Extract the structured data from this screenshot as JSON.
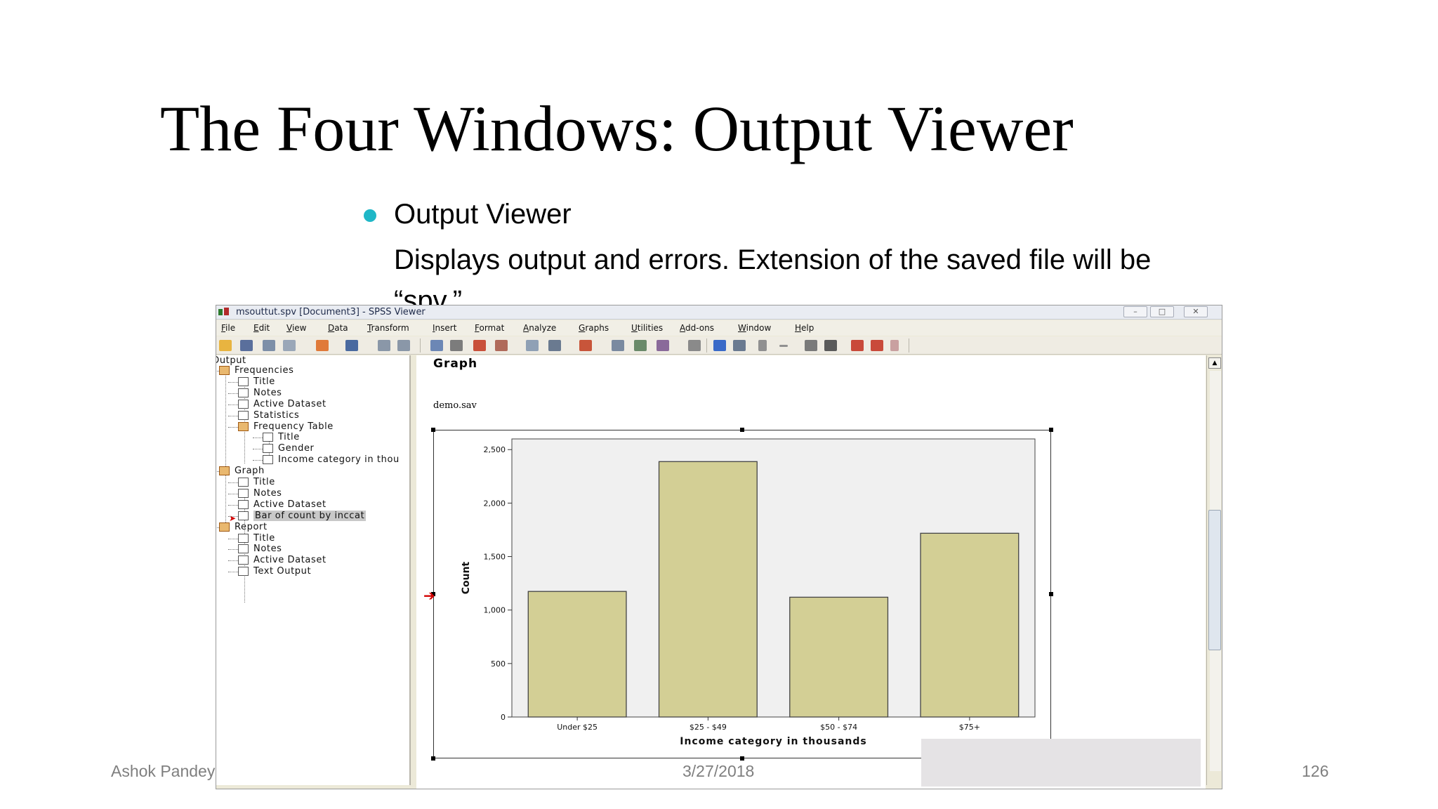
{
  "slide": {
    "title": "The Four Windows: Output Viewer",
    "bullet_heading": "Output Viewer",
    "bullet_text": "Displays output and errors. Extension of the saved file will be “spv.”",
    "bullet_color": "#1fb7c7"
  },
  "footer": {
    "author": "Ashok Pandey",
    "date": "3/27/2018",
    "page_number": "126"
  },
  "window": {
    "title": "msouttut.spv [Document3] - SPSS Viewer",
    "controls": [
      "–",
      "□",
      "✕"
    ]
  },
  "menu": [
    "File",
    "Edit",
    "View",
    "Data",
    "Transform",
    "Insert",
    "Format",
    "Analyze",
    "Graphs",
    "Utilities",
    "Add-ons",
    "Window",
    "Help"
  ],
  "toolbar_icons": [
    "open-icon",
    "save-icon",
    "print-icon",
    "print-preview-icon",
    "export-icon",
    "recall-dialog-icon",
    "undo-icon",
    "redo-icon",
    "goto-data-icon",
    "goto-case-icon",
    "goto-variable-icon",
    "variables-icon",
    "use-sets-icon",
    "show-all-variables-icon",
    "spell-check-icon",
    "insert-heading-icon",
    "insert-title-icon",
    "insert-text-icon",
    "designate-window-icon",
    "back-icon",
    "forward-icon",
    "expand-icon",
    "collapse-icon",
    "show-icon",
    "hide-icon",
    "insert-output-icon",
    "promote-icon",
    "demote-icon"
  ],
  "outline": {
    "root": "Output",
    "items": [
      {
        "label": "Frequencies",
        "level": 1,
        "icon": "book-icon"
      },
      {
        "label": "Title",
        "level": 2,
        "icon": "title-icon"
      },
      {
        "label": "Notes",
        "level": 2,
        "icon": "notes-icon"
      },
      {
        "label": "Active Dataset",
        "level": 2,
        "icon": "log-icon"
      },
      {
        "label": "Statistics",
        "level": 2,
        "icon": "table-icon"
      },
      {
        "label": "Frequency Table",
        "level": 2,
        "icon": "book-icon"
      },
      {
        "label": "Title",
        "level": 3,
        "icon": "title-icon"
      },
      {
        "label": "Gender",
        "level": 3,
        "icon": "table-icon"
      },
      {
        "label": "Income category in thou",
        "level": 3,
        "icon": "table-icon"
      },
      {
        "label": "Graph",
        "level": 1,
        "icon": "book-icon"
      },
      {
        "label": "Title",
        "level": 2,
        "icon": "title-icon"
      },
      {
        "label": "Notes",
        "level": 2,
        "icon": "notes-icon"
      },
      {
        "label": "Active Dataset",
        "level": 2,
        "icon": "log-icon"
      },
      {
        "label": "Bar of count by inccat",
        "level": 2,
        "icon": "chart-icon",
        "selected": true
      },
      {
        "label": "Report",
        "level": 1,
        "icon": "book-icon"
      },
      {
        "label": "Title",
        "level": 2,
        "icon": "title-icon"
      },
      {
        "label": "Notes",
        "level": 2,
        "icon": "notes-icon"
      },
      {
        "label": "Active Dataset",
        "level": 2,
        "icon": "log-icon"
      },
      {
        "label": "Text Output",
        "level": 2,
        "icon": "text-icon"
      }
    ]
  },
  "output": {
    "heading": "Graph",
    "dataset": "demo.sav"
  },
  "chart_data": {
    "type": "bar",
    "categories": [
      "Under $25",
      "$25 - $49",
      "$50 - $74",
      "$75+"
    ],
    "values": [
      1174,
      2388,
      1120,
      1718
    ],
    "xlabel": "Income category in thousands",
    "ylabel": "Count",
    "ylim": [
      0,
      2600
    ],
    "yticks": [
      0,
      500,
      1000,
      1500,
      2000,
      2500
    ],
    "ytick_labels": [
      "0",
      "500",
      "1,000",
      "1,500",
      "2,000",
      "2,500"
    ],
    "bar_color": "#d3cf95",
    "plot_background": "#f0f0f0",
    "grid": false,
    "legend": "none"
  }
}
